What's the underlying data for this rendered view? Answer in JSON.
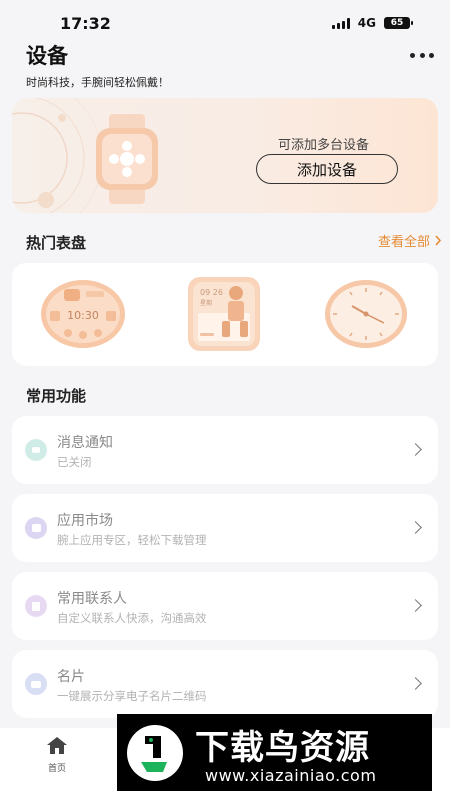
{
  "status_bar": {
    "time": "17:32",
    "network": "4G",
    "battery": "65"
  },
  "header": {
    "title": "设备",
    "subtitle": "时尚科技，手腕间轻松佩戴！"
  },
  "device_card": {
    "hint": "可添加多台设备",
    "add_button_label": "添加设备"
  },
  "hot_faces": {
    "title": "热门表盘",
    "view_all_label": "查看全部",
    "face1_time": "10:30",
    "face2_date": "09 26",
    "face2_day": "星期"
  },
  "functions": {
    "title": "常用功能",
    "items": [
      {
        "label": "消息通知",
        "desc": "已关闭"
      },
      {
        "label": "应用市场",
        "desc": "腕上应用专区，轻松下载管理"
      },
      {
        "label": "常用联系人",
        "desc": "自定义联系人快添，沟通高效"
      },
      {
        "label": "名片",
        "desc": "一键展示分享电子名片二维码"
      }
    ]
  },
  "tab_bar": {
    "home_label": "首页"
  },
  "watermark": {
    "title": "下载鸟资源",
    "url": "www.xiazainiao.com"
  },
  "colors": {
    "accent": "#e58b34",
    "background": "#f5f5f7"
  }
}
